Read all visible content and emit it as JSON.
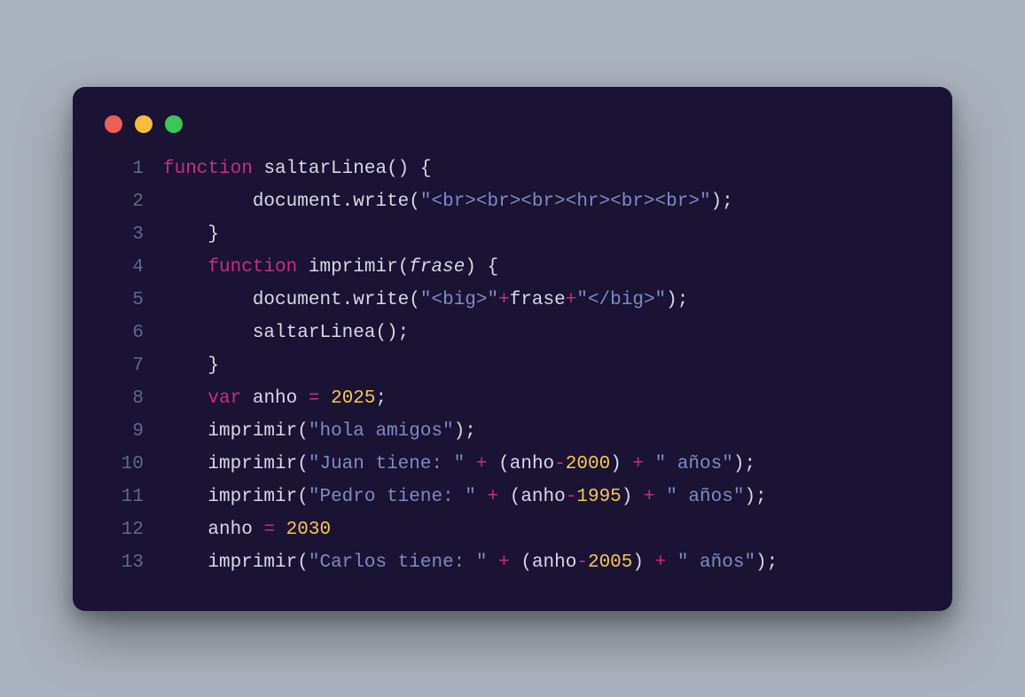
{
  "window": {
    "traffic_lights": {
      "red": "#ec5f57",
      "yellow": "#f6bd3b",
      "green": "#3bc656"
    }
  },
  "code": {
    "lines": [
      {
        "n": "1",
        "tokens": [
          {
            "cls": "tok-keyword",
            "t": "function"
          },
          {
            "cls": "tok-punct",
            "t": " "
          },
          {
            "cls": "tok-funcname",
            "t": "saltarLinea"
          },
          {
            "cls": "tok-paren",
            "t": "()"
          },
          {
            "cls": "tok-punct",
            "t": " "
          },
          {
            "cls": "tok-brace",
            "t": "{"
          }
        ]
      },
      {
        "n": "2",
        "tokens": [
          {
            "cls": "tok-punct",
            "t": "        "
          },
          {
            "cls": "tok-obj",
            "t": "document"
          },
          {
            "cls": "tok-punct",
            "t": "."
          },
          {
            "cls": "tok-funcname",
            "t": "write"
          },
          {
            "cls": "tok-paren",
            "t": "("
          },
          {
            "cls": "tok-string",
            "t": "\"<br><br><br><hr><br><br>\""
          },
          {
            "cls": "tok-paren",
            "t": ")"
          },
          {
            "cls": "tok-punct",
            "t": ";"
          }
        ]
      },
      {
        "n": "3",
        "tokens": [
          {
            "cls": "tok-punct",
            "t": "    "
          },
          {
            "cls": "tok-brace",
            "t": "}"
          }
        ]
      },
      {
        "n": "4",
        "tokens": [
          {
            "cls": "tok-punct",
            "t": "    "
          },
          {
            "cls": "tok-keyword",
            "t": "function"
          },
          {
            "cls": "tok-punct",
            "t": " "
          },
          {
            "cls": "tok-funcname",
            "t": "imprimir"
          },
          {
            "cls": "tok-paren",
            "t": "("
          },
          {
            "cls": "tok-param",
            "t": "frase"
          },
          {
            "cls": "tok-paren",
            "t": ")"
          },
          {
            "cls": "tok-punct",
            "t": " "
          },
          {
            "cls": "tok-brace",
            "t": "{"
          }
        ]
      },
      {
        "n": "5",
        "tokens": [
          {
            "cls": "tok-punct",
            "t": "        "
          },
          {
            "cls": "tok-obj",
            "t": "document"
          },
          {
            "cls": "tok-punct",
            "t": "."
          },
          {
            "cls": "tok-funcname",
            "t": "write"
          },
          {
            "cls": "tok-paren",
            "t": "("
          },
          {
            "cls": "tok-string",
            "t": "\"<big>\""
          },
          {
            "cls": "tok-op",
            "t": "+"
          },
          {
            "cls": "tok-ident",
            "t": "frase"
          },
          {
            "cls": "tok-op",
            "t": "+"
          },
          {
            "cls": "tok-string",
            "t": "\"</big>\""
          },
          {
            "cls": "tok-paren",
            "t": ")"
          },
          {
            "cls": "tok-punct",
            "t": ";"
          }
        ]
      },
      {
        "n": "6",
        "tokens": [
          {
            "cls": "tok-punct",
            "t": "        "
          },
          {
            "cls": "tok-funcname",
            "t": "saltarLinea"
          },
          {
            "cls": "tok-paren",
            "t": "()"
          },
          {
            "cls": "tok-punct",
            "t": ";"
          }
        ]
      },
      {
        "n": "7",
        "tokens": [
          {
            "cls": "tok-punct",
            "t": "    "
          },
          {
            "cls": "tok-brace",
            "t": "}"
          }
        ]
      },
      {
        "n": "8",
        "tokens": [
          {
            "cls": "tok-punct",
            "t": "    "
          },
          {
            "cls": "tok-keyword",
            "t": "var"
          },
          {
            "cls": "tok-punct",
            "t": " "
          },
          {
            "cls": "tok-ident",
            "t": "anho"
          },
          {
            "cls": "tok-punct",
            "t": " "
          },
          {
            "cls": "tok-op",
            "t": "="
          },
          {
            "cls": "tok-punct",
            "t": " "
          },
          {
            "cls": "tok-num",
            "t": "2025"
          },
          {
            "cls": "tok-punct",
            "t": ";"
          }
        ]
      },
      {
        "n": "9",
        "tokens": [
          {
            "cls": "tok-punct",
            "t": "    "
          },
          {
            "cls": "tok-funcname",
            "t": "imprimir"
          },
          {
            "cls": "tok-paren",
            "t": "("
          },
          {
            "cls": "tok-string",
            "t": "\"hola amigos\""
          },
          {
            "cls": "tok-paren",
            "t": ")"
          },
          {
            "cls": "tok-punct",
            "t": ";"
          }
        ]
      },
      {
        "n": "10",
        "tokens": [
          {
            "cls": "tok-punct",
            "t": "    "
          },
          {
            "cls": "tok-funcname",
            "t": "imprimir"
          },
          {
            "cls": "tok-paren",
            "t": "("
          },
          {
            "cls": "tok-string",
            "t": "\"Juan tiene: \""
          },
          {
            "cls": "tok-punct",
            "t": " "
          },
          {
            "cls": "tok-op",
            "t": "+"
          },
          {
            "cls": "tok-punct",
            "t": " "
          },
          {
            "cls": "tok-paren",
            "t": "("
          },
          {
            "cls": "tok-ident",
            "t": "anho"
          },
          {
            "cls": "tok-op",
            "t": "-"
          },
          {
            "cls": "tok-num",
            "t": "2000"
          },
          {
            "cls": "tok-paren",
            "t": ")"
          },
          {
            "cls": "tok-punct",
            "t": " "
          },
          {
            "cls": "tok-op",
            "t": "+"
          },
          {
            "cls": "tok-punct",
            "t": " "
          },
          {
            "cls": "tok-string",
            "t": "\" años\""
          },
          {
            "cls": "tok-paren",
            "t": ")"
          },
          {
            "cls": "tok-punct",
            "t": ";"
          }
        ]
      },
      {
        "n": "11",
        "tokens": [
          {
            "cls": "tok-punct",
            "t": "    "
          },
          {
            "cls": "tok-funcname",
            "t": "imprimir"
          },
          {
            "cls": "tok-paren",
            "t": "("
          },
          {
            "cls": "tok-string",
            "t": "\"Pedro tiene: \""
          },
          {
            "cls": "tok-punct",
            "t": " "
          },
          {
            "cls": "tok-op",
            "t": "+"
          },
          {
            "cls": "tok-punct",
            "t": " "
          },
          {
            "cls": "tok-paren",
            "t": "("
          },
          {
            "cls": "tok-ident",
            "t": "anho"
          },
          {
            "cls": "tok-op",
            "t": "-"
          },
          {
            "cls": "tok-num",
            "t": "1995"
          },
          {
            "cls": "tok-paren",
            "t": ")"
          },
          {
            "cls": "tok-punct",
            "t": " "
          },
          {
            "cls": "tok-op",
            "t": "+"
          },
          {
            "cls": "tok-punct",
            "t": " "
          },
          {
            "cls": "tok-string",
            "t": "\" años\""
          },
          {
            "cls": "tok-paren",
            "t": ")"
          },
          {
            "cls": "tok-punct",
            "t": ";"
          }
        ]
      },
      {
        "n": "12",
        "tokens": [
          {
            "cls": "tok-punct",
            "t": "    "
          },
          {
            "cls": "tok-ident",
            "t": "anho"
          },
          {
            "cls": "tok-punct",
            "t": " "
          },
          {
            "cls": "tok-op",
            "t": "="
          },
          {
            "cls": "tok-punct",
            "t": " "
          },
          {
            "cls": "tok-num",
            "t": "2030"
          }
        ]
      },
      {
        "n": "13",
        "tokens": [
          {
            "cls": "tok-punct",
            "t": "    "
          },
          {
            "cls": "tok-funcname",
            "t": "imprimir"
          },
          {
            "cls": "tok-paren",
            "t": "("
          },
          {
            "cls": "tok-string",
            "t": "\"Carlos tiene: \""
          },
          {
            "cls": "tok-punct",
            "t": " "
          },
          {
            "cls": "tok-op",
            "t": "+"
          },
          {
            "cls": "tok-punct",
            "t": " "
          },
          {
            "cls": "tok-paren",
            "t": "("
          },
          {
            "cls": "tok-ident",
            "t": "anho"
          },
          {
            "cls": "tok-op",
            "t": "-"
          },
          {
            "cls": "tok-num",
            "t": "2005"
          },
          {
            "cls": "tok-paren",
            "t": ")"
          },
          {
            "cls": "tok-punct",
            "t": " "
          },
          {
            "cls": "tok-op",
            "t": "+"
          },
          {
            "cls": "tok-punct",
            "t": " "
          },
          {
            "cls": "tok-string",
            "t": "\" años\""
          },
          {
            "cls": "tok-paren",
            "t": ")"
          },
          {
            "cls": "tok-punct",
            "t": ";"
          }
        ]
      }
    ]
  }
}
